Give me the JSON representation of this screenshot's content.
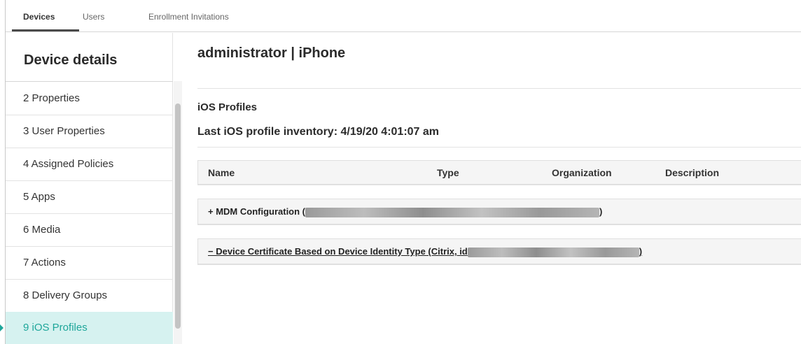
{
  "tabs": [
    {
      "label": "Devices",
      "active": true
    },
    {
      "label": "Users",
      "active": false
    },
    {
      "label": "Enrollment Invitations",
      "active": false
    }
  ],
  "sidebar": {
    "title": "Device details",
    "items": [
      {
        "label": "2 Properties"
      },
      {
        "label": "3 User Properties"
      },
      {
        "label": "4 Assigned Policies"
      },
      {
        "label": "5 Apps"
      },
      {
        "label": "6 Media"
      },
      {
        "label": "7 Actions"
      },
      {
        "label": "8 Delivery Groups"
      },
      {
        "label": "9 iOS Profiles",
        "active": true
      }
    ]
  },
  "main": {
    "title": "administrator | iPhone",
    "section_title": "iOS Profiles",
    "inventory": "Last iOS profile inventory: 4/19/20 4:01:07 am",
    "columns": [
      "Name",
      "Type",
      "Organization",
      "Description"
    ],
    "rows": [
      {
        "prefix": "+ MDM Configuration (",
        "suffix": ")"
      },
      {
        "prefix": "− Device Certificate Based on Device Identity Type (Citrix, id",
        "suffix": ")"
      }
    ]
  },
  "colors": {
    "accent": "#1ea69a",
    "active_bg": "#d6f2f0"
  }
}
